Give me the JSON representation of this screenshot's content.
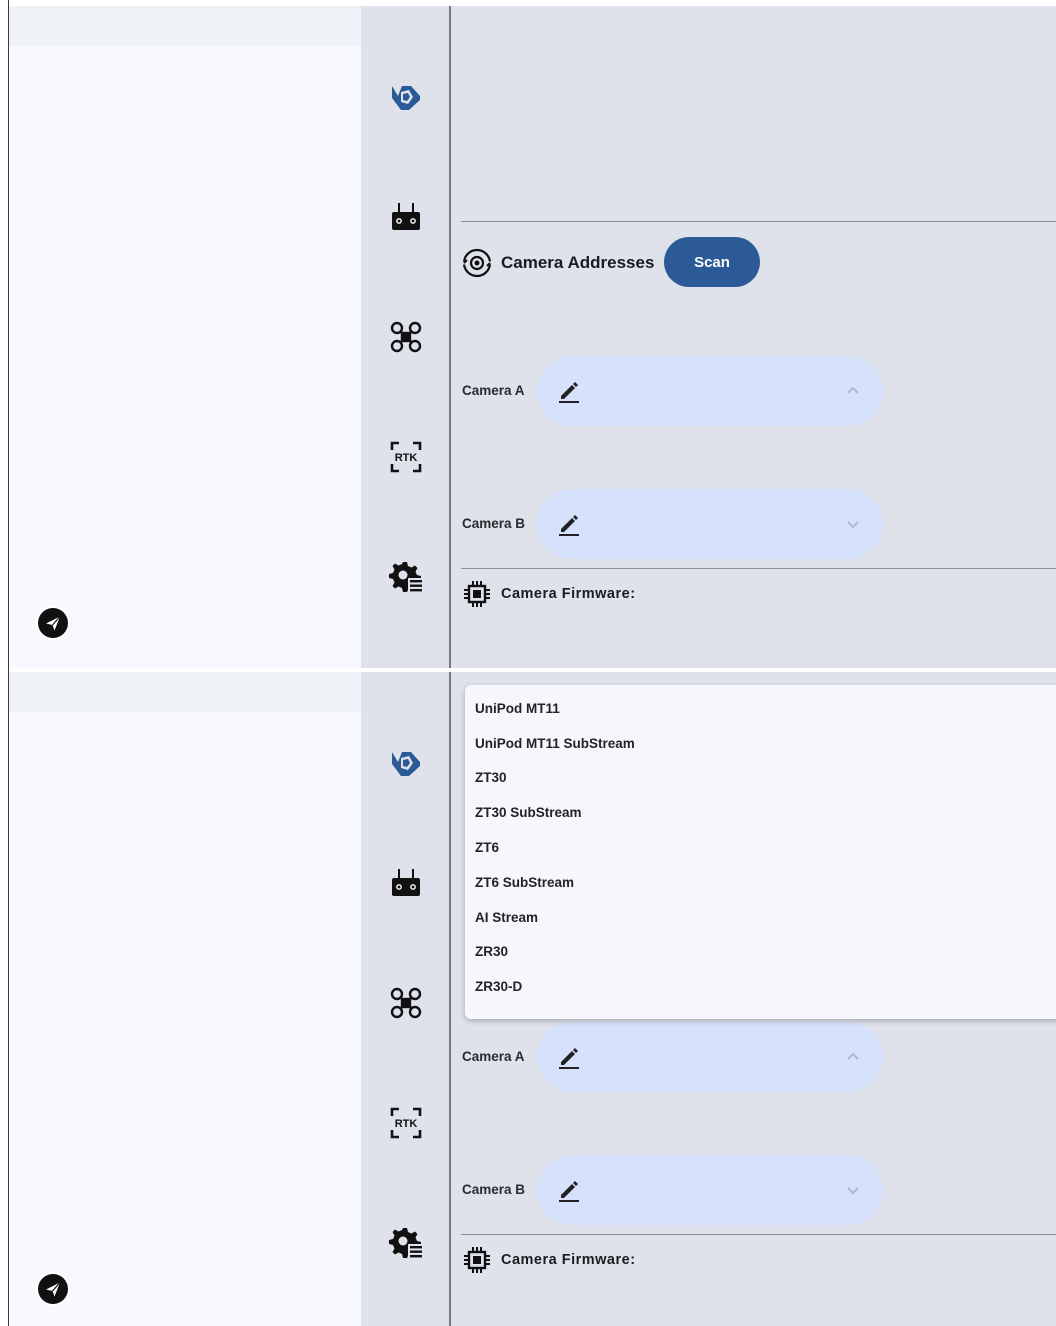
{
  "screen_top": {
    "camera_addresses": {
      "title": "Camera Addresses",
      "scan_label": "Scan"
    },
    "camera_a": {
      "label": "Camera A"
    },
    "camera_b": {
      "label": "Camera B"
    },
    "firmware": {
      "label": "Camera Firmware:"
    }
  },
  "screen_bottom": {
    "dropdown_options": [
      "UniPod MT11",
      "UniPod MT11 SubStream",
      "ZT30",
      "ZT30 SubStream",
      "ZT6",
      "ZT6 SubStream",
      "AI Stream",
      "ZR30",
      "ZR30-D"
    ],
    "camera_a": {
      "label": "Camera A"
    },
    "camera_b": {
      "label": "Camera B"
    },
    "firmware": {
      "label": "Camera Firmware:"
    }
  },
  "rail": {
    "items": [
      {
        "icon": "camera-shutter-icon"
      },
      {
        "icon": "remote-controller-icon"
      },
      {
        "icon": "drone-icon"
      },
      {
        "icon": "rtk-icon",
        "text": "RTK"
      },
      {
        "icon": "gear-list-icon"
      }
    ]
  },
  "colors": {
    "accent": "#2c5a96",
    "field_bg": "#d6e2fb",
    "rail_bg": "#dfe2eb",
    "panel_bg": "#f7f9fe"
  }
}
